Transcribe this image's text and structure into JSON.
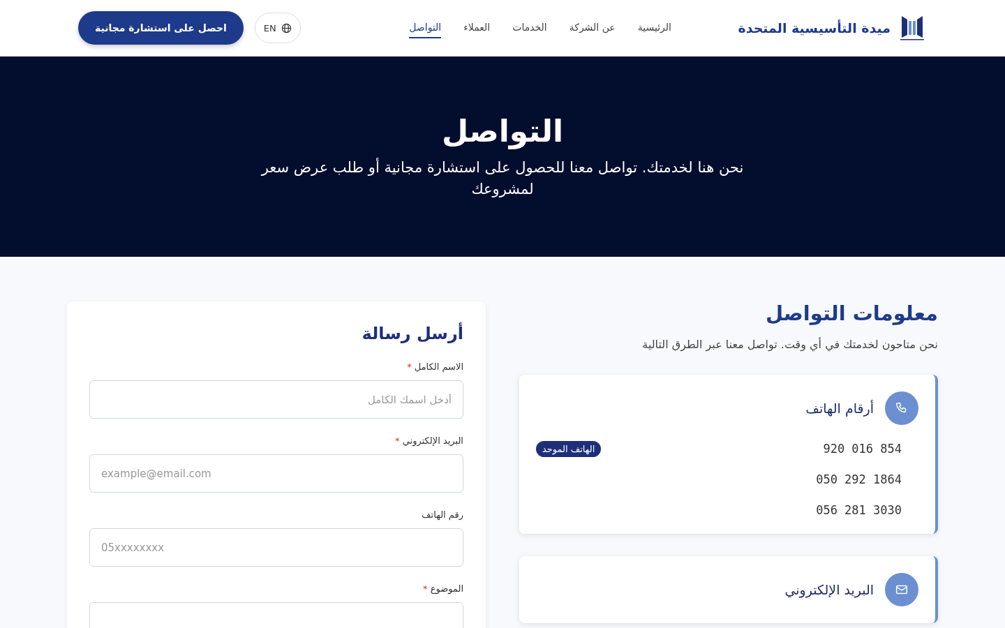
{
  "header": {
    "brand": "ميدة التأسيسية المتحدة",
    "nav": [
      {
        "label": "الرئيسية",
        "selected": false
      },
      {
        "label": "عن الشركة",
        "selected": false
      },
      {
        "label": "الخدمات",
        "selected": false
      },
      {
        "label": "العملاء",
        "selected": false
      },
      {
        "label": "التواصل",
        "selected": true
      }
    ],
    "language": "EN",
    "cta": "احصل على استشارة مجانية"
  },
  "hero": {
    "title": "التواصل",
    "subtitle": "نحن هنا لخدمتك. تواصل معنا للحصول على استشارة مجانية أو طلب عرض سعر لمشروعك"
  },
  "contact_info": {
    "title": "معلومات التواصل",
    "subtitle": "نحن متاحون لخدمتك في أي وقت. تواصل معنا عبر الطرق التالية",
    "cards": [
      {
        "kind": "phone",
        "title": "أرقام الهاتف",
        "entries": [
          {
            "value": "920 016 854",
            "badge": "الهاتف الموحد"
          },
          {
            "value": "050 292 1864"
          },
          {
            "value": "056 281 3030"
          }
        ]
      },
      {
        "kind": "email",
        "title": "البريد الإلكتروني"
      }
    ]
  },
  "form": {
    "title": "أرسل رسالة",
    "required_mark": "*",
    "fields": [
      {
        "label": "الاسم الكامل",
        "required": true,
        "placeholder": "أدخل اسمك الكامل",
        "kind": "text"
      },
      {
        "label": "البريد الإلكتروني",
        "required": true,
        "placeholder": "example@email.com",
        "kind": "email"
      },
      {
        "label": "رقم الهاتف",
        "required": false,
        "placeholder": "05xxxxxxxx",
        "kind": "tel"
      },
      {
        "label": "الموضوع",
        "required": true
      }
    ]
  }
}
